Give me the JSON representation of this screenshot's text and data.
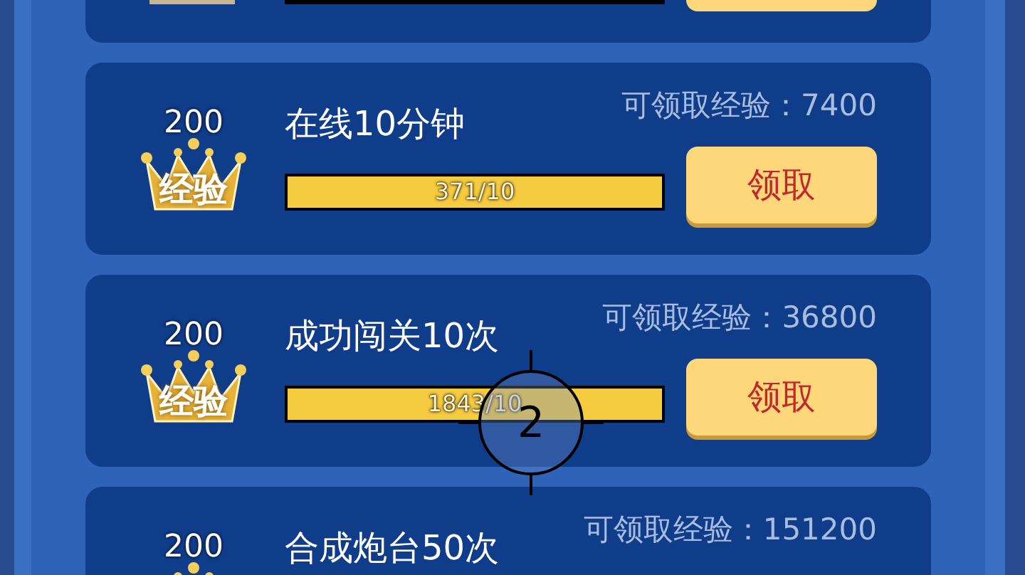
{
  "tasks": [
    {
      "badge_amount": "200",
      "badge_label": "经验",
      "title": "在线10分钟",
      "reward": "可领取经验：7400",
      "progress_text": "371/10",
      "level": 1,
      "button": "领取"
    },
    {
      "badge_amount": "200",
      "badge_label": "经验",
      "title": "成功闯关10次",
      "reward": "可领取经验：36800",
      "progress_text": "1843/10",
      "level": 1,
      "button": "领取"
    },
    {
      "badge_amount": "200",
      "title": "合成炮台50次",
      "reward": "可领取经验：151200"
    }
  ],
  "touch_marker": {
    "label": "2"
  }
}
